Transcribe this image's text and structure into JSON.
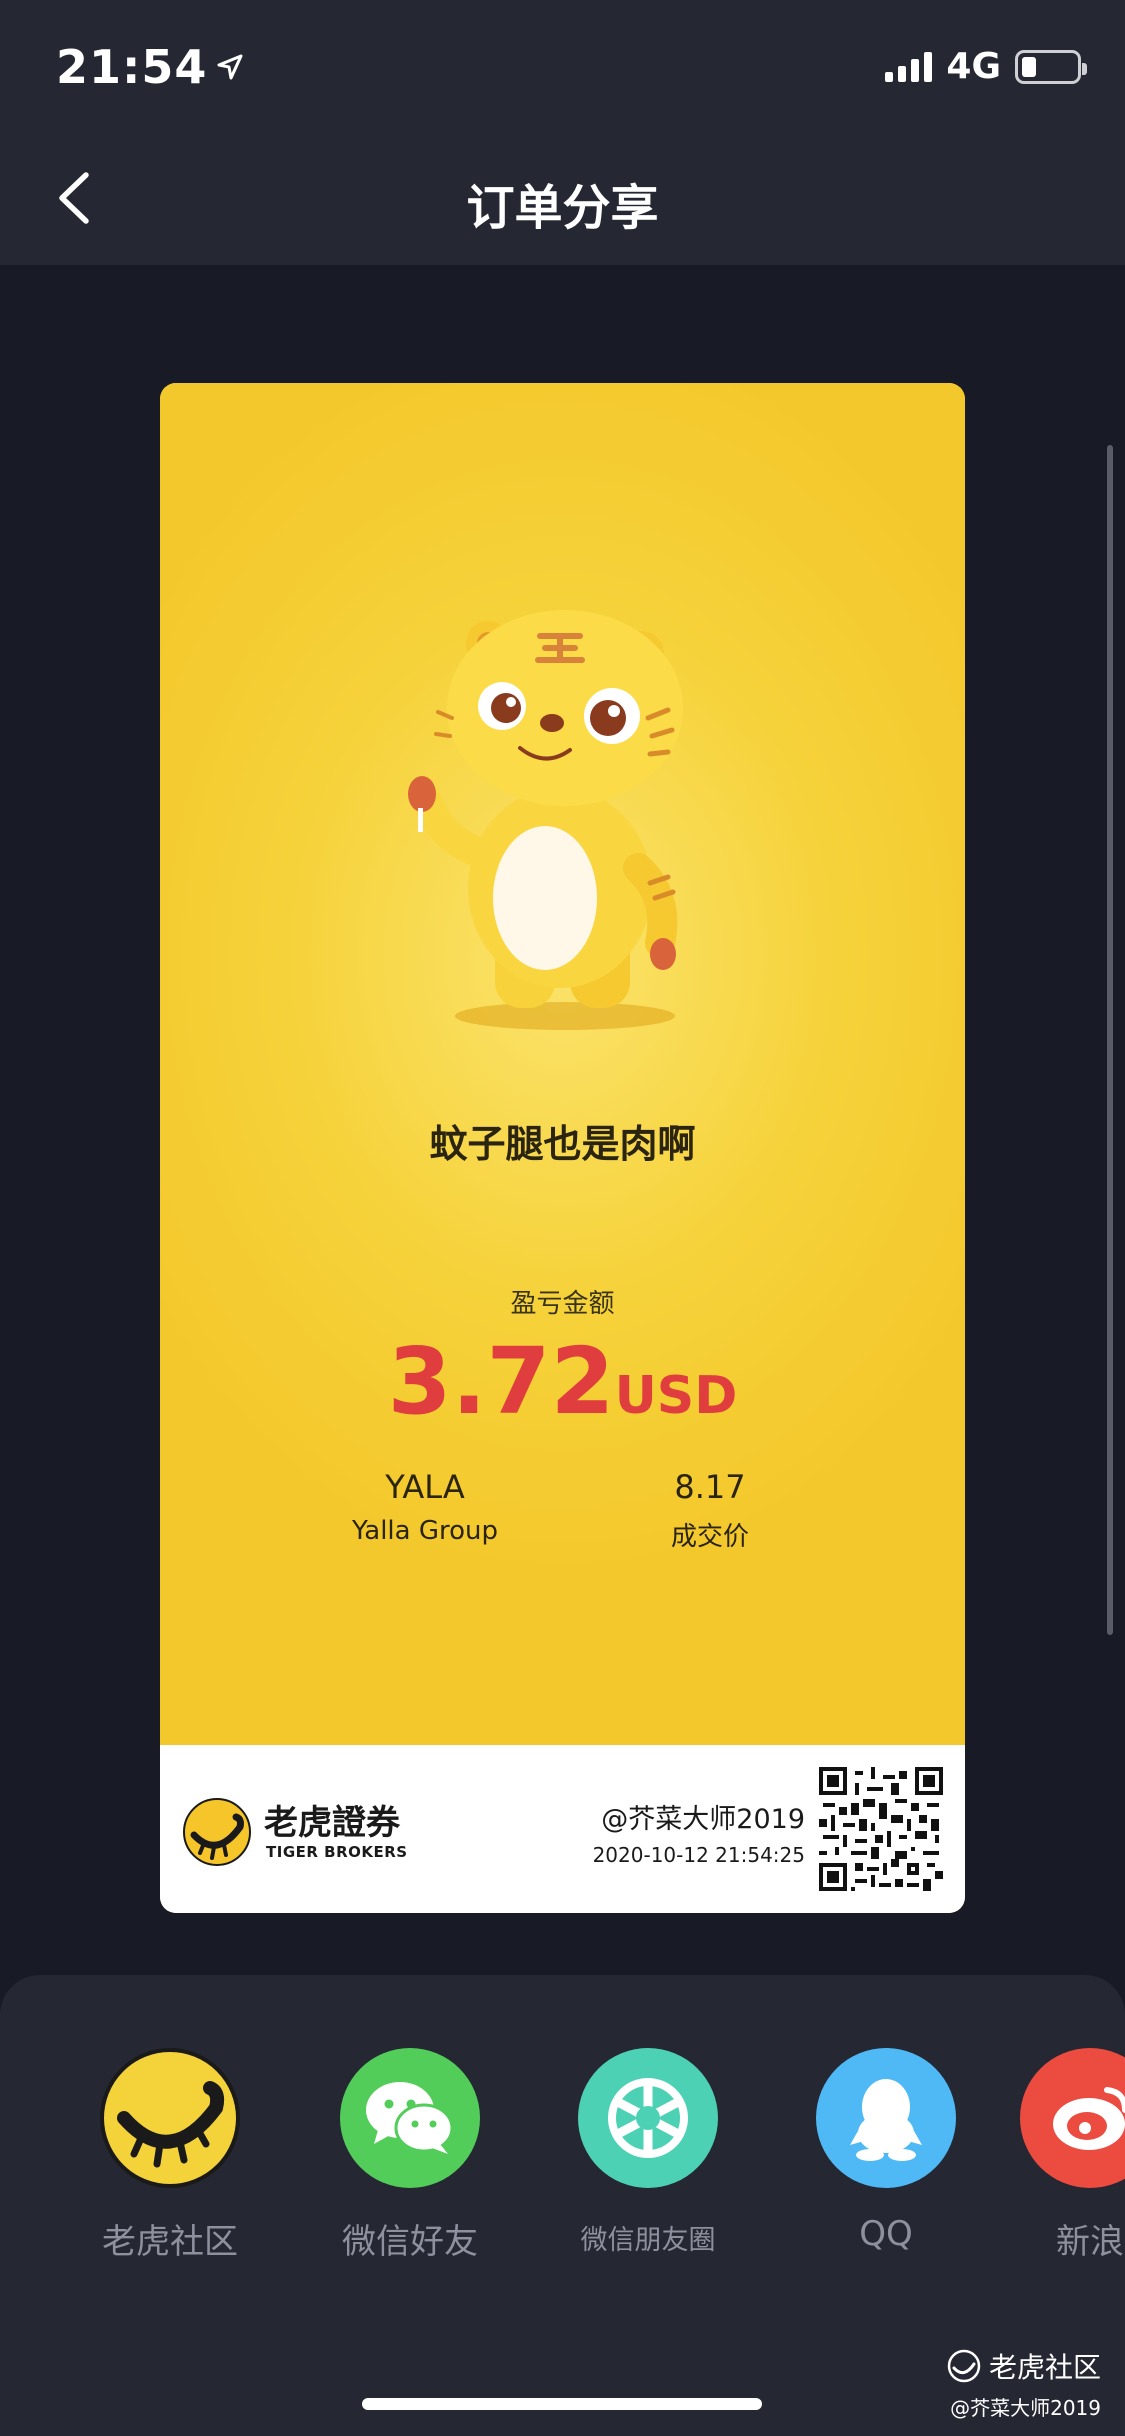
{
  "status_bar": {
    "time": "21:54",
    "network": "4G"
  },
  "nav": {
    "title": "订单分享",
    "back_icon": "chevron-left-icon"
  },
  "card": {
    "slogan": "蚊子腿也是肉啊",
    "pnl_label": "盈亏金额",
    "pnl_value": "3.72",
    "pnl_unit": "USD",
    "ticker": "YALA",
    "company": "Yalla Group",
    "price": "8.17",
    "price_label": "成交价",
    "footer": {
      "brand_cn": "老虎證券",
      "brand_en": "TIGER BROKERS",
      "user_handle": "@芥菜大师2019",
      "timestamp": "2020-10-12 21:54:25"
    }
  },
  "share_targets": [
    {
      "label": "老虎社区",
      "icon": "tiger-community-icon",
      "color": "#f4d23a"
    },
    {
      "label": "微信好友",
      "icon": "wechat-icon",
      "color": "#52cd5a"
    },
    {
      "label": "微信朋友圈",
      "icon": "moments-icon",
      "color": "#4dd1b4"
    },
    {
      "label": "QQ",
      "icon": "qq-icon",
      "color": "#4fb9f5"
    },
    {
      "label": "新浪",
      "icon": "weibo-icon",
      "color": "#ec4b3f"
    }
  ],
  "watermark": {
    "line1": "老虎社区",
    "line2": "@芥菜大师2019"
  },
  "colors": {
    "background": "#181a25",
    "bar": "#252733",
    "card_yellow": "#f5c52a",
    "pnl_red": "#e03e3e"
  }
}
